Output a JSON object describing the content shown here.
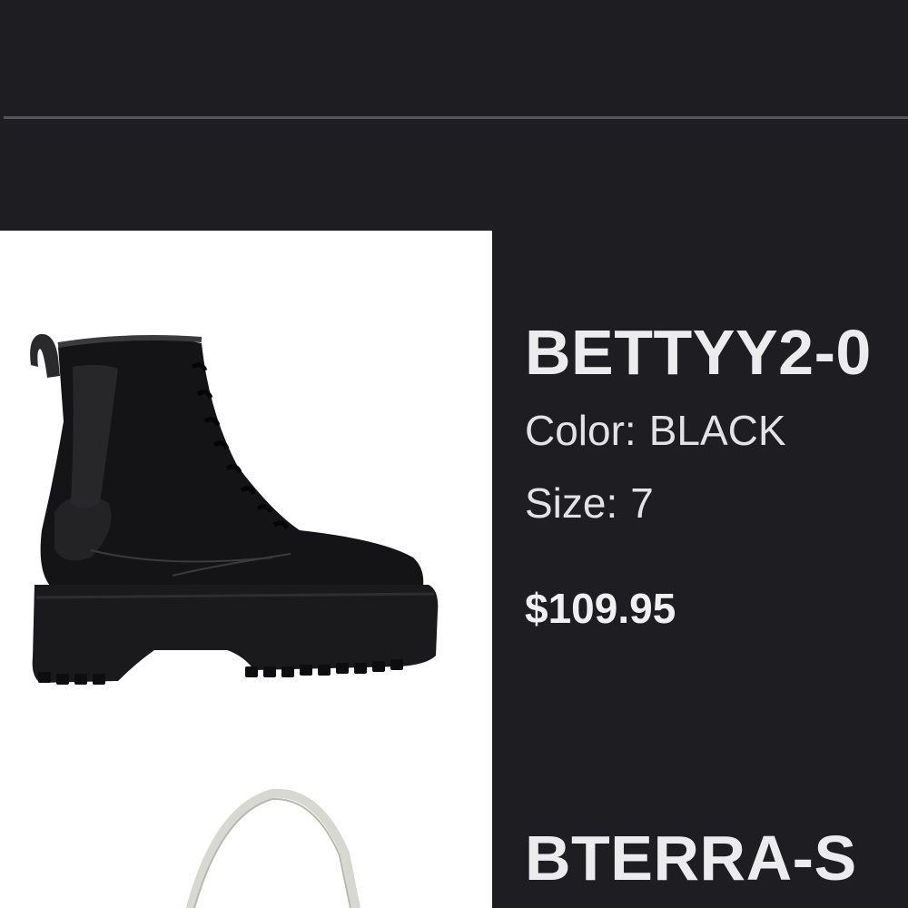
{
  "cart": {
    "items": [
      {
        "name": "BETTYY2-0",
        "color_label": "Color:",
        "color_value": "BLACK",
        "size_label": "Size:",
        "size_value": "7",
        "price": "$109.95",
        "image_icon": "black-platform-boot-image"
      },
      {
        "name": "BTERRA-S",
        "image_icon": "white-handbag-image"
      }
    ]
  },
  "colors": {
    "background": "#1d1d22",
    "divider": "#55565b",
    "text": "#ececee",
    "thumb_background": "#ffffff"
  }
}
